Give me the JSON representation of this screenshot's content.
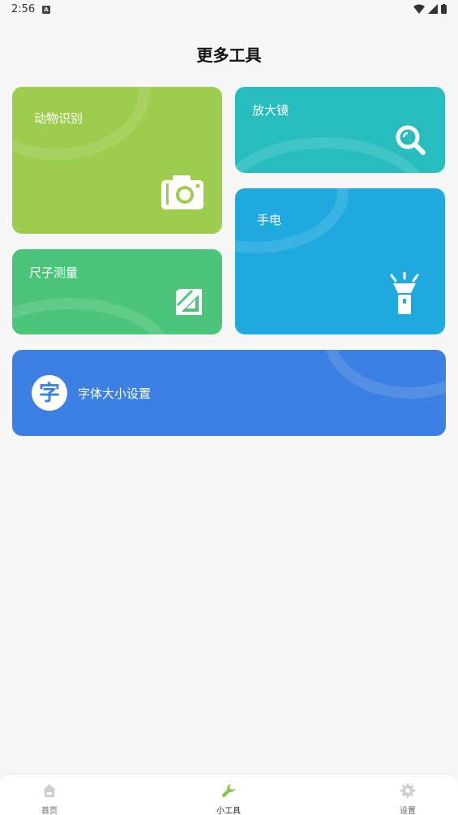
{
  "status": {
    "time": "2:56"
  },
  "page": {
    "title": "更多工具"
  },
  "tools": {
    "animal": {
      "label": "动物识别",
      "icon": "camera-icon",
      "color": "#9ccd4c"
    },
    "magnifier": {
      "label": "放大镜",
      "icon": "search-icon",
      "color": "#27bdbf"
    },
    "ruler": {
      "label": "尺子测量",
      "icon": "ruler-icon",
      "color": "#4cc57a"
    },
    "flashlight": {
      "label": "手电",
      "icon": "flashlight-icon",
      "color": "#1eaadf"
    },
    "font": {
      "label": "字体大小设置",
      "badge": "字",
      "icon": "font-size-icon",
      "color": "#3d80e3"
    }
  },
  "nav": {
    "home": {
      "label": "首页",
      "icon": "home-icon"
    },
    "tools": {
      "label": "小工具",
      "icon": "wrench-icon",
      "active": true,
      "accent": "#8bc34a"
    },
    "settings": {
      "label": "设置",
      "icon": "gear-icon"
    }
  }
}
